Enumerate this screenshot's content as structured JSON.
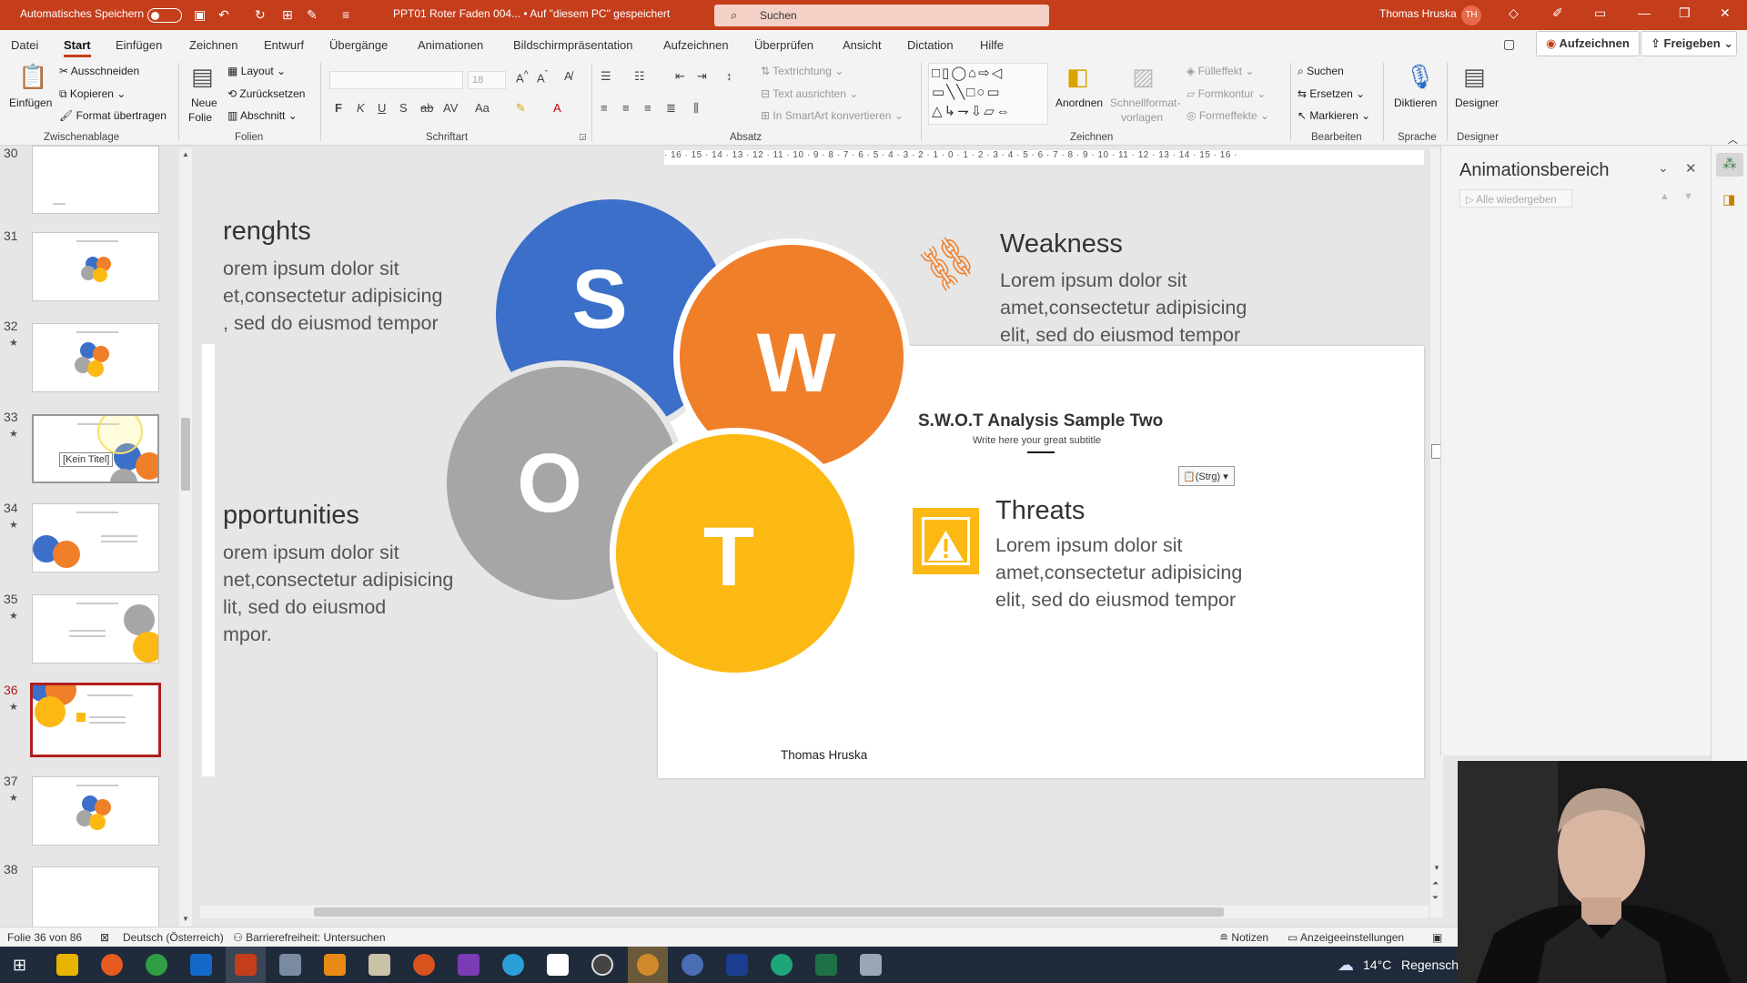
{
  "titlebar": {
    "autosave": "Automatisches Speichern",
    "doc_title": "PPT01 Roter Faden 004...  •  Auf \"diesem PC\" gespeichert",
    "search_label": "Suchen",
    "user_name": "Thomas Hruska",
    "user_initials": "TH"
  },
  "menu": {
    "tabs": [
      "Datei",
      "Start",
      "Einfügen",
      "Zeichnen",
      "Entwurf",
      "Übergänge",
      "Animationen",
      "Bildschirmpräsentation",
      "Aufzeichnen",
      "Überprüfen",
      "Ansicht",
      "Dictation",
      "Hilfe"
    ],
    "record_button": "Aufzeichnen",
    "share_button": "Freigeben"
  },
  "ribbon": {
    "clipboard": {
      "paste": "Einfügen",
      "cut": "Ausschneiden",
      "copy": "Kopieren",
      "format_painter": "Format übertragen",
      "group": "Zwischenablage"
    },
    "slides": {
      "new_slide_1": "Neue",
      "new_slide_2": "Folie",
      "layout": "Layout",
      "reset": "Zurücksetzen",
      "section": "Abschnitt",
      "group": "Folien"
    },
    "font": {
      "size": "18",
      "group": "Schriftart",
      "case_label": "Aa"
    },
    "paragraph": {
      "text_direction": "Textrichtung",
      "align_text": "Text ausrichten",
      "smartart": "In SmartArt konvertieren",
      "group": "Absatz"
    },
    "drawing": {
      "arrange": "Anordnen",
      "quick_styles_1": "Schnellformat-",
      "quick_styles_2": "vorlagen",
      "fill": "Fülleffekt",
      "outline": "Formkontur",
      "effects": "Formeffekte",
      "group": "Zeichnen"
    },
    "editing": {
      "find": "Suchen",
      "replace": "Ersetzen",
      "select": "Markieren",
      "group": "Bearbeiten"
    },
    "voice": {
      "dictate": "Diktieren",
      "group": "Sprache"
    },
    "designer": {
      "designer": "Designer",
      "group": "Designer"
    }
  },
  "thumbnails": [
    {
      "num": "30",
      "star": ""
    },
    {
      "num": "31",
      "star": ""
    },
    {
      "num": "32",
      "star": "★"
    },
    {
      "num": "33",
      "star": "★",
      "tooltip": "[Kein Titel]"
    },
    {
      "num": "34",
      "star": "★"
    },
    {
      "num": "35",
      "star": "★"
    },
    {
      "num": "36",
      "star": "★"
    },
    {
      "num": "37",
      "star": "★"
    },
    {
      "num": "38",
      "star": ""
    }
  ],
  "ruler": {
    "ticks": "· 16 · 15 · 14 · 13 · 12 · 11 · 10 · 9 · 8 · 7 · 6 · 5 · 4 · 3 · 2 · 1 · 0 · 1 · 2 · 3 · 4 · 5 · 6 · 7 · 8 · 9 · 10 · 11 · 12 · 13 · 14 · 15 · 16 ·"
  },
  "slide_behind": {
    "strengths_title": "renghts",
    "strengths_lines": [
      "orem ipsum dolor sit",
      "et,consectetur adipisicing",
      ", sed do eiusmod tempor"
    ],
    "weakness_title": "Weakness",
    "weakness_lines": [
      "Lorem ipsum dolor sit",
      "amet,consectetur adipisicing",
      "elit, sed do eiusmod tempor"
    ],
    "opportunities_title": "pportunities",
    "opportunities_lines": [
      "orem ipsum dolor sit",
      "net,consectetur adipisicing",
      "lit, sed do eiusmod",
      "mpor."
    ],
    "threats_title": "Threats",
    "threats_lines": [
      "Lorem ipsum dolor sit",
      "amet,consectetur adipisicing",
      "elit, sed do eiusmod tempor"
    ],
    "letters": {
      "s": "S",
      "w": "W",
      "o": "O",
      "t": "T"
    }
  },
  "slide": {
    "title": "S.W.O.T Analysis Sample Two",
    "subtitle": "Write here your great subtitle",
    "footer": "Thomas Hruska",
    "paste_options": "(Strg)"
  },
  "animation_pane": {
    "title": "Animationsbereich",
    "play_all": "Alle wiedergeben"
  },
  "status": {
    "slide_info": "Folie 36 von 86",
    "language": "Deutsch (Österreich)",
    "accessibility": "Barrierefreiheit: Untersuchen",
    "notes": "Notizen",
    "display_settings": "Anzeigeeinstellungen"
  },
  "taskbar": {
    "temperature": "14°C",
    "weather": "Regensch"
  },
  "colors": {
    "accent": "#c43e1c",
    "swot_s": "#3b6fca",
    "swot_w": "#f07f2a",
    "swot_o": "#a6a6a6",
    "swot_t": "#fdb913"
  }
}
